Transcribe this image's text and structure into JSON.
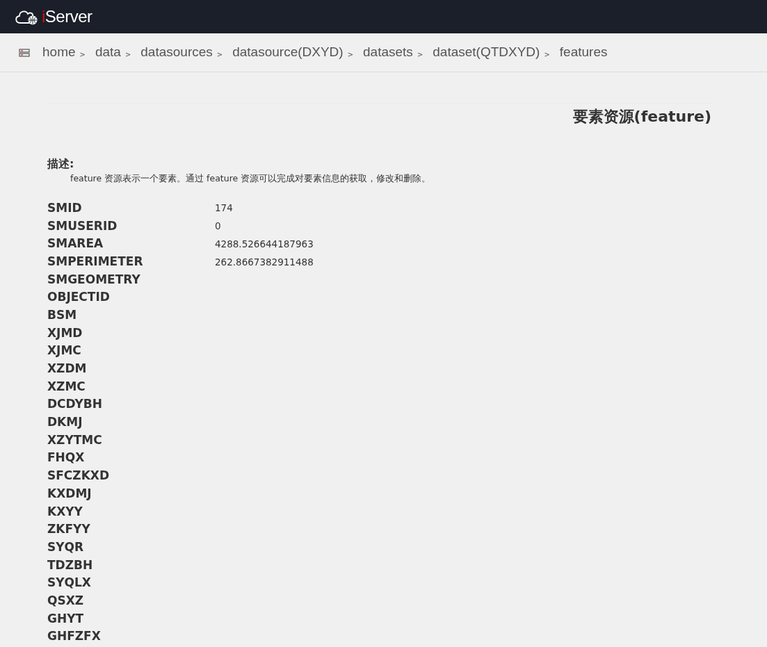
{
  "header": {
    "logo_prefix": "i",
    "logo_rest": "Server"
  },
  "breadcrumb": {
    "separator": ">",
    "items": [
      "home",
      "data",
      "datasources",
      "datasource(DXYD)",
      "datasets",
      "dataset(QTDXYD)",
      "features"
    ]
  },
  "title": "要素资源(feature)",
  "description": {
    "heading": "描述:",
    "text": "feature 资源表示一个要素。通过 feature 资源可以完成对要素信息的获取，修改和删除。"
  },
  "fields": [
    {
      "name": "SMID",
      "value": "174"
    },
    {
      "name": "SMUSERID",
      "value": "0"
    },
    {
      "name": "SMAREA",
      "value": "4288.526644187963"
    },
    {
      "name": "SMPERIMETER",
      "value": "262.8667382911488"
    },
    {
      "name": "SMGEOMETRY"
    },
    {
      "name": "OBJECTID"
    },
    {
      "name": "BSM"
    },
    {
      "name": "XJMD"
    },
    {
      "name": "XJMC"
    },
    {
      "name": "XZDM"
    },
    {
      "name": "XZMC"
    },
    {
      "name": "DCDYBH"
    },
    {
      "name": "DKMJ"
    },
    {
      "name": "XZYTMC"
    },
    {
      "name": "FHQX"
    },
    {
      "name": "SFCZKXD"
    },
    {
      "name": "KXDMJ"
    },
    {
      "name": "KXYY"
    },
    {
      "name": "ZKFYY"
    },
    {
      "name": "SYQR"
    },
    {
      "name": "TDZBH"
    },
    {
      "name": "SYQLX"
    },
    {
      "name": "QSXZ"
    },
    {
      "name": "GHYT"
    },
    {
      "name": "GHFZFX"
    }
  ]
}
